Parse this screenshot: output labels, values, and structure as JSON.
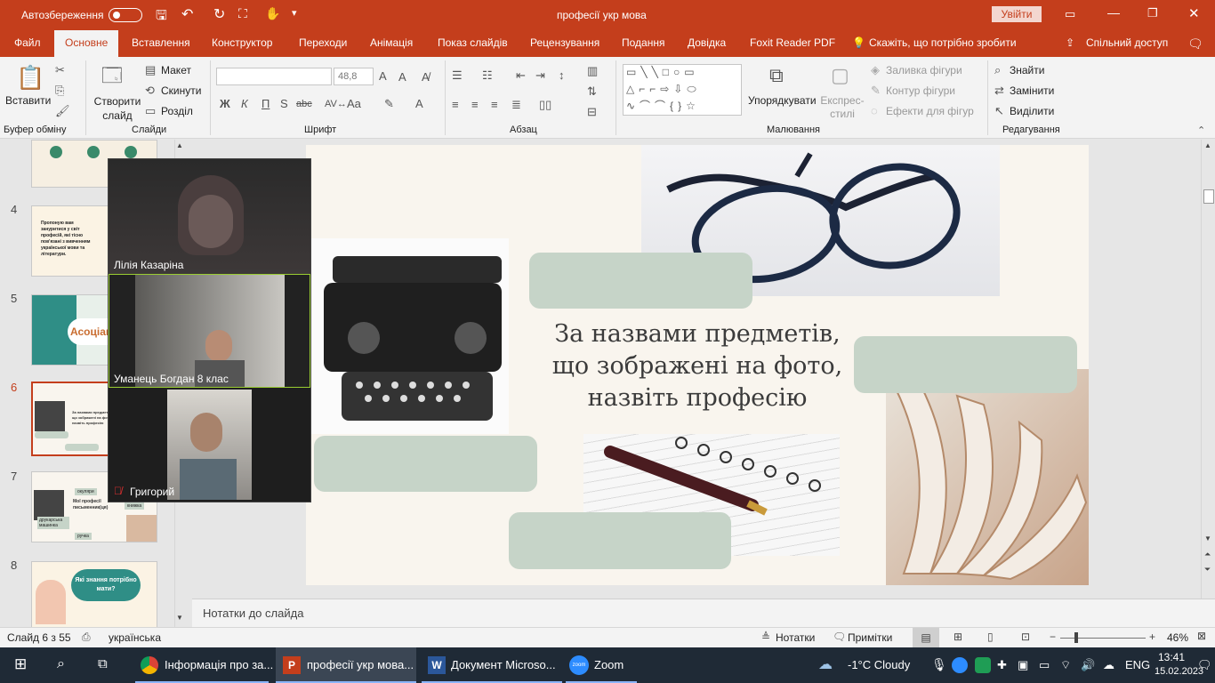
{
  "titlebar": {
    "autosave": "Автозбереження",
    "doc_title": "професії укр мова",
    "update": "Увійти"
  },
  "tabs": [
    "Файл",
    "Основне",
    "Вставлення",
    "Конструктор",
    "Переходи",
    "Анімація",
    "Показ слайдів",
    "Рецензування",
    "Подання",
    "Довідка",
    "Foxit Reader PDF"
  ],
  "tell_me": "Скажіть, що потрібно зробити",
  "share": "Спільний доступ",
  "ribbon": {
    "paste": "Вставити",
    "clipboard": "Буфер обміну",
    "new_slide": "Створити слайд",
    "layout": "Макет",
    "reset": "Скинути",
    "section": "Розділ",
    "slides": "Слайди",
    "font_size": "48,8",
    "font_group": "Шрифт",
    "bold": "Ж",
    "italic": "К",
    "underline": "П",
    "strike": "S",
    "abc": "abc",
    "aa": "Aa",
    "paragraph": "Абзац",
    "arrange": "Упорядкувати",
    "quick_styles": "Експрес-стилі",
    "shape_fill": "Заливка фігури",
    "shape_outline": "Контур фігури",
    "shape_effects": "Ефекти для фігур",
    "drawing": "Малювання",
    "find": "Знайти",
    "replace": "Замінити",
    "select": "Виділити",
    "editing": "Редагування"
  },
  "thumbs": [
    {
      "num": "4",
      "text": "Пропоную вам зануритися у світ професій, які тісно пов'язані з вивченням української мови та літератури."
    },
    {
      "num": "5",
      "text": "Асоціації"
    },
    {
      "num": "6",
      "text": "За назвами предметів, що зображені на фото, назвіть професію"
    },
    {
      "num": "7",
      "text": "Мої професії письменник(ця)"
    },
    {
      "num": "8",
      "text": "Які знання потрібно мати?"
    }
  ],
  "thumb7_labels": [
    "окуляри",
    "книжка",
    "друкарська машинка",
    "ручка"
  ],
  "slide": {
    "title": "За назвами предметів, що зображені на фото, назвіть професію"
  },
  "video": {
    "p1": "Лілія Казаріна",
    "p2": "Уманець Богдан 8 клас",
    "p3": "Григорий"
  },
  "notes": "Нотатки до слайда",
  "status": {
    "slide": "Слайд 6 з 55",
    "lang": "українська",
    "notes": "Нотатки",
    "comments": "Примітки",
    "zoom": "46%"
  },
  "taskbar": {
    "chrome": "Інформація про за...",
    "ppt": "професії укр мова...",
    "word": "Документ Microso...",
    "zoom": "Zoom",
    "weather": "-1°C  Cloudy",
    "lang": "ENG",
    "time": "13:41",
    "date": "15.02.2023"
  },
  "colors": {
    "accent": "#c43e1c",
    "taskbar": "#1f2a36",
    "slide_bg": "#f9f5ee",
    "box": "#c6d4c8"
  }
}
